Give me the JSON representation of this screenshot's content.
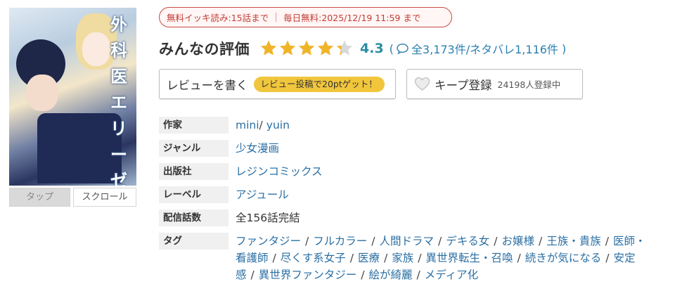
{
  "cover": {
    "title_chars": [
      "外",
      "科",
      "医",
      "エ",
      "リ",
      "ー",
      "ゼ"
    ],
    "alt": "外科医エリーゼ"
  },
  "view_tabs": {
    "tap": "タップ",
    "scroll": "スクロール"
  },
  "campaign": {
    "free_read": "無料イッキ読み:15話まで",
    "daily_free": "毎日無料:2025/12/19 11:59 まで"
  },
  "rating": {
    "title": "みんなの評価",
    "score": "4.3",
    "stars_value": 4.3,
    "stars_max": 5,
    "open_paren": "(",
    "counts": "全3,173件/ネタバレ1,116件",
    "close_paren": ")"
  },
  "buttons": {
    "write_review": "レビューを書く",
    "review_reward": "レビュー投稿で20ptゲット！",
    "keep": "キープ登録",
    "keep_count": "24198人登録中"
  },
  "info": {
    "author_label": "作家",
    "authors": [
      "mini",
      "yuin"
    ],
    "genre_label": "ジャンル",
    "genre": "少女漫画",
    "publisher_label": "出版社",
    "publisher": "レジンコミックス",
    "label_label": "レーベル",
    "label": "アジュール",
    "episodes_label": "配信話数",
    "episodes": "全156話完結",
    "tags_label": "タグ",
    "tags": [
      "ファンタジー",
      "フルカラー",
      "人間ドラマ",
      "デキる女",
      "お嬢様",
      "王族・貴族",
      "医師・看護師",
      "尽くす系女子",
      "医療",
      "家族",
      "異世界転生・召喚",
      "続きが気になる",
      "安定感",
      "異世界ファンタジー",
      "絵が綺麗",
      "メディア化"
    ]
  },
  "colors": {
    "star": "#f0b429",
    "star_empty": "#d9d9d9",
    "score": "#2b8ea5",
    "link": "#2b6fa3",
    "badge_border": "#c94a43",
    "pill": "#f1c63c"
  }
}
